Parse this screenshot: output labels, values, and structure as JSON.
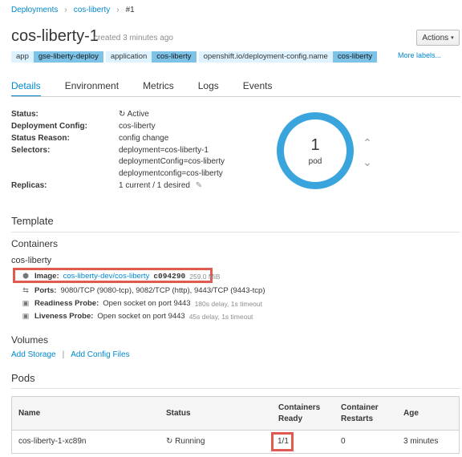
{
  "breadcrumb": {
    "items": [
      "Deployments",
      "cos-liberty",
      "#1"
    ],
    "sep": "›"
  },
  "header": {
    "title": "cos-liberty-1",
    "created": "created 3 minutes ago",
    "actions_label": "Actions",
    "actions_chevron": "▾",
    "labels": [
      {
        "key": "app",
        "value": "gse-liberty-deploy"
      },
      {
        "key": "application",
        "value": "cos-liberty"
      },
      {
        "key": "openshift.io/deployment-config.name",
        "value": "cos-liberty"
      }
    ],
    "more_labels": "More labels..."
  },
  "tabs": [
    "Details",
    "Environment",
    "Metrics",
    "Logs",
    "Events"
  ],
  "details": {
    "status_label": "Status:",
    "status_icon": "↻",
    "status_value": "Active",
    "config_label": "Deployment Config:",
    "config_value": "cos-liberty",
    "reason_label": "Status Reason:",
    "reason_value": "config change",
    "selectors_label": "Selectors:",
    "selectors": [
      "deployment=cos-liberty-1",
      "deploymentConfig=cos-liberty",
      "deploymentconfig=cos-liberty"
    ],
    "replicas_label": "Replicas:",
    "replicas_value": "1 current / 1 desired",
    "edit_icon": "✎"
  },
  "pod_donut": {
    "count": "1",
    "label": "pod",
    "up": "⌃",
    "down": "⌄"
  },
  "template": {
    "heading": "Template",
    "containers_heading": "Containers",
    "container_name": "cos-liberty",
    "image_label": "Image:",
    "image_link": "cos-liberty-dev/cos-liberty",
    "image_hash": "c094290",
    "image_size": "259.0 MiB",
    "ports_label": "Ports:",
    "ports_value": "9080/TCP (9080-tcp), 9082/TCP (http), 9443/TCP (9443-tcp)",
    "readiness_label": "Readiness Probe:",
    "readiness_value": "Open socket on port 9443",
    "readiness_muted": "180s delay, 1s timeout",
    "liveness_label": "Liveness Probe:",
    "liveness_value": "Open socket on port 9443",
    "liveness_muted": "45s delay, 1s timeout",
    "icons": {
      "image": "⬢",
      "ports": "⇆",
      "readiness": "▣",
      "liveness": "▣"
    }
  },
  "volumes": {
    "heading": "Volumes",
    "add_storage": "Add Storage",
    "pipe": "|",
    "add_config": "Add Config Files"
  },
  "pods": {
    "heading": "Pods",
    "headers": {
      "name": "Name",
      "status": "Status",
      "ready_1": "Containers",
      "ready_2": "Ready",
      "restarts_1": "Container",
      "restarts_2": "Restarts",
      "age": "Age"
    },
    "rows": [
      {
        "name": "cos-liberty-1-xc89n",
        "status_icon": "↻",
        "status": "Running",
        "ready": "1/1",
        "restarts": "0",
        "age": "3 minutes"
      }
    ]
  },
  "colors": {
    "accent": "#0088ce",
    "donut": "#39a5dc",
    "highlight": "#e05b4f"
  }
}
